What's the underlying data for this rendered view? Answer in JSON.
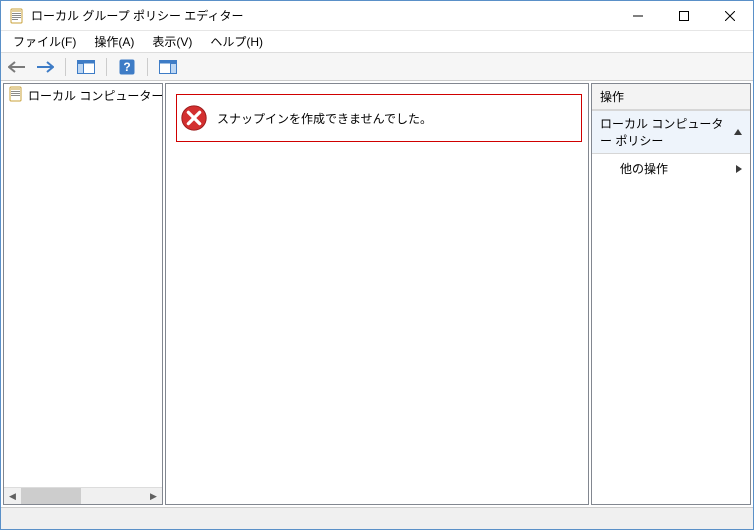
{
  "window": {
    "title": "ローカル グループ ポリシー エディター"
  },
  "menu": {
    "file": "ファイル(F)",
    "action": "操作(A)",
    "view": "表示(V)",
    "help": "ヘルプ(H)"
  },
  "tree": {
    "root": "ローカル コンピューター ポリシ"
  },
  "error": {
    "message": "スナップインを作成できませんでした。"
  },
  "actions": {
    "header": "操作",
    "item": "ローカル コンピューター ポリシー",
    "sub": "他の操作"
  }
}
